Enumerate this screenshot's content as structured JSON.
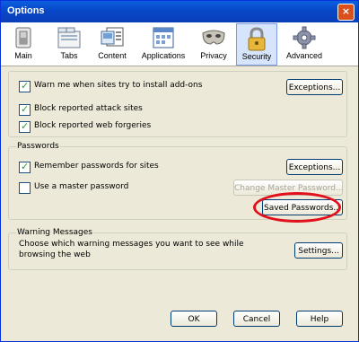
{
  "window": {
    "title": "Options",
    "close_glyph": "×"
  },
  "tabs": [
    {
      "label": "Main",
      "icon": "switch-icon"
    },
    {
      "label": "Tabs",
      "icon": "folder-tabs-icon"
    },
    {
      "label": "Content",
      "icon": "content-icon"
    },
    {
      "label": "Applications",
      "icon": "applications-icon"
    },
    {
      "label": "Privacy",
      "icon": "mask-icon"
    },
    {
      "label": "Security",
      "icon": "lock-icon",
      "selected": true
    },
    {
      "label": "Advanced",
      "icon": "gear-icon"
    }
  ],
  "addons": {
    "warn_install": {
      "label": "Warn me when sites try to install add-ons",
      "checked": true
    },
    "exceptions_label": "Exceptions...",
    "block_attack": {
      "label": "Block reported attack sites",
      "checked": true
    },
    "block_forgery": {
      "label": "Block reported web forgeries",
      "checked": true
    }
  },
  "passwords": {
    "title": "Passwords",
    "remember": {
      "label": "Remember passwords for sites",
      "checked": true
    },
    "exceptions_label": "Exceptions...",
    "master": {
      "label": "Use a master password",
      "checked": false
    },
    "change_master_label": "Change Master Password...",
    "saved_label": "Saved Passwords..."
  },
  "warnings": {
    "title": "Warning Messages",
    "description": "Choose which warning messages you want to see while browsing the web",
    "settings_label": "Settings..."
  },
  "footer": {
    "ok_label": "OK",
    "cancel_label": "Cancel",
    "help_label": "Help"
  },
  "colors": {
    "titlebar": "#0a5fe0",
    "highlight": "#e2101a",
    "face": "#ece9d8"
  }
}
